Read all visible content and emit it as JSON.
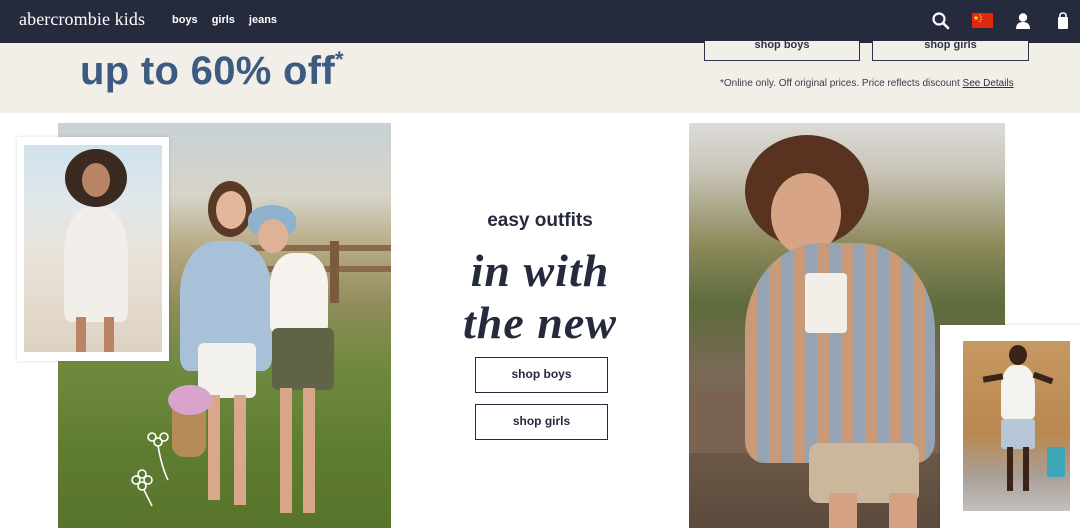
{
  "header": {
    "logo": "abercrombie kids",
    "nav": [
      "boys",
      "girls",
      "jeans"
    ],
    "icons": [
      "search-icon",
      "china-flag-icon",
      "account-icon",
      "shopping-bag-icon"
    ]
  },
  "promo": {
    "headline": "up to 60% off",
    "asterisk": "*",
    "buttons": [
      "shop boys",
      "shop girls"
    ],
    "fine_print": "*Online only. Off original prices. Price reflects discount",
    "details_link": "See Details"
  },
  "feature": {
    "eyebrow": "easy outfits",
    "headline_line1": "in with",
    "headline_line2": "the new",
    "buttons": [
      "shop boys",
      "shop girls"
    ]
  },
  "colors": {
    "header_bg": "#252a3d",
    "promo_bg": "#f2efe8",
    "promo_text": "#3d5a80"
  }
}
